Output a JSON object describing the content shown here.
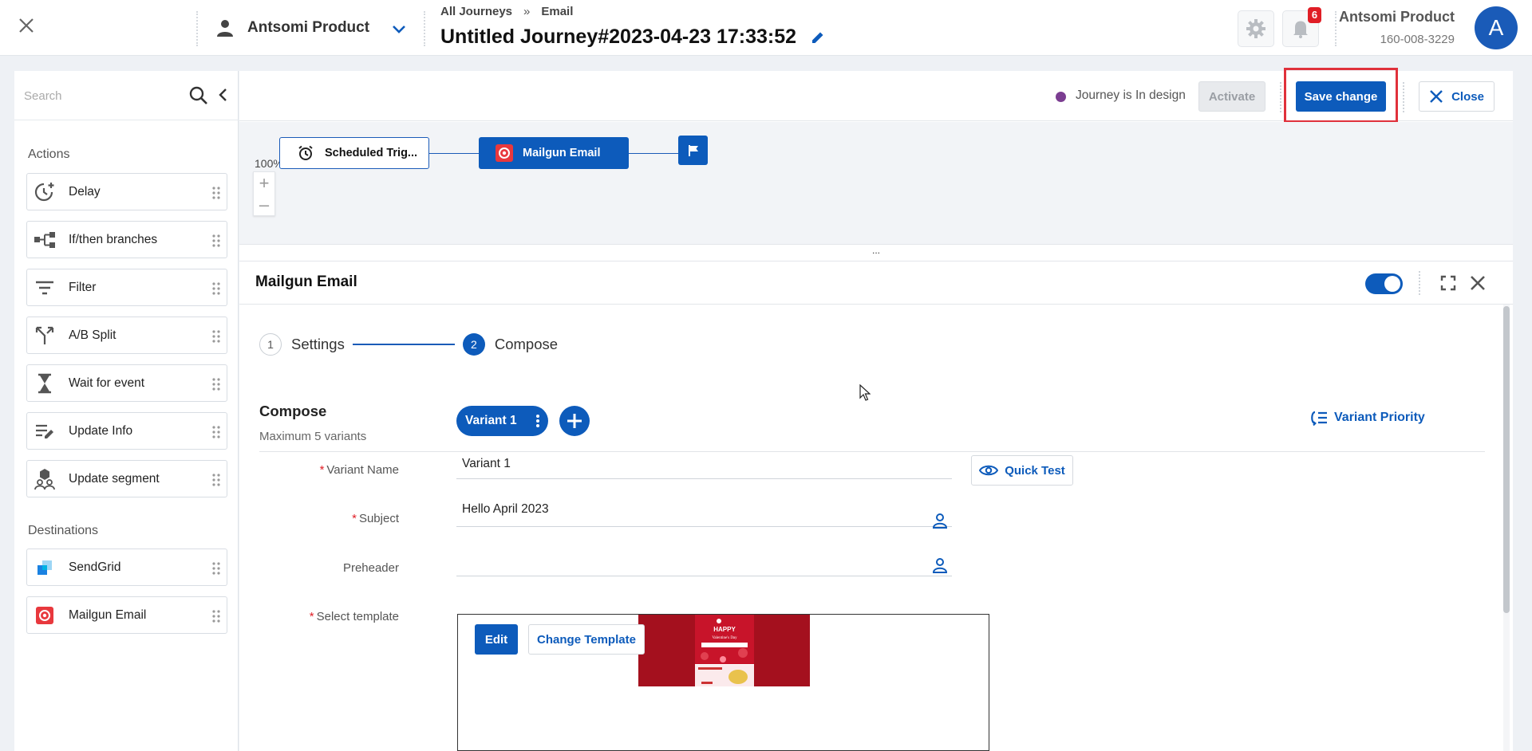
{
  "header": {
    "account_name": "Antsomi Product",
    "breadcrumb": {
      "parent": "All Journeys",
      "separator": "»",
      "current": "Email"
    },
    "journey_title": "Untitled Journey#2023-04-23 17:33:52",
    "notification_count": "6",
    "user": {
      "name": "Antsomi Product",
      "id": "160-008-3229",
      "avatar_letter": "A"
    }
  },
  "sidebar": {
    "search_placeholder": "Search",
    "actions_heading": "Actions",
    "actions": [
      {
        "label": "Delay",
        "icon": "delay-icon"
      },
      {
        "label": "If/then branches",
        "icon": "branch-icon"
      },
      {
        "label": "Filter",
        "icon": "filter-icon"
      },
      {
        "label": "A/B Split",
        "icon": "split-icon"
      },
      {
        "label": "Wait for event",
        "icon": "hourglass-icon"
      },
      {
        "label": "Update Info",
        "icon": "edit-list-icon"
      },
      {
        "label": "Update segment",
        "icon": "segment-icon"
      }
    ],
    "destinations_heading": "Destinations",
    "destinations": [
      {
        "label": "SendGrid",
        "icon": "sendgrid-icon"
      },
      {
        "label": "Mailgun Email",
        "icon": "mailgun-icon"
      }
    ]
  },
  "actionbar": {
    "status": "Journey is In design",
    "status_color": "#7b3d91",
    "activate_label": "Activate",
    "save_label": "Save change",
    "close_label": "Close"
  },
  "canvas": {
    "zoom": "100%",
    "nodes": {
      "trigger": "Scheduled Trig...",
      "mailgun": "Mailgun Email"
    },
    "resizer_label": "..."
  },
  "node_panel": {
    "title": "Mailgun Email",
    "enabled": true,
    "steps": [
      {
        "number": "1",
        "label": "Settings"
      },
      {
        "number": "2",
        "label": "Compose"
      }
    ],
    "compose": {
      "title": "Compose",
      "subtitle": "Maximum 5 variants",
      "variant_label": "Variant 1",
      "variant_priority_label": "Variant Priority",
      "quick_test_label": "Quick Test",
      "fields": {
        "variant_name": {
          "label": "Variant Name",
          "value": "Variant 1"
        },
        "subject": {
          "label": "Subject",
          "value": "Hello April 2023"
        },
        "preheader": {
          "label": "Preheader",
          "value": ""
        },
        "template": {
          "label": "Select template",
          "edit_label": "Edit",
          "change_label": "Change Template"
        }
      }
    }
  },
  "colors": {
    "primary": "#0d5bbb",
    "highlight": "#e0313b",
    "template_red": "#a4101e"
  }
}
